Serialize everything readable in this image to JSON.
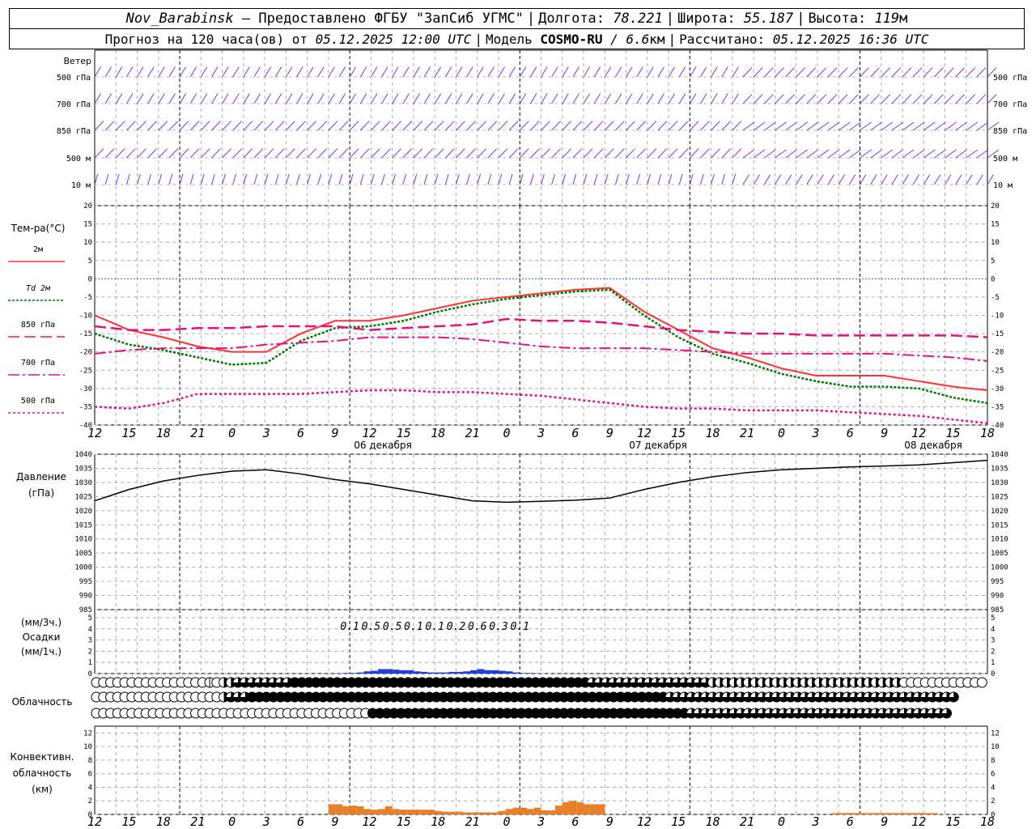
{
  "header": {
    "station": "Nov_Barabinsk",
    "provider": "— Предоставлено ФГБУ \"ЗапСиб УГМС\"",
    "lon_label": "Долгота:",
    "lon": "78.221",
    "lat_label": "Широта:",
    "lat": "55.187",
    "alt_label": "Высота:",
    "alt": "119",
    "alt_unit": "м",
    "fc_label": "Прогноз на 120 часа(ов) от",
    "fc_start": "05.12.2025 12:00 UTC",
    "model_label": "Модель",
    "model": "COSMO-RU",
    "model_res": "/ 6.6",
    "model_res_unit": "км",
    "calc_label": "Рассчитано:",
    "calc_time": "05.12.2025 16:36 UTC",
    "sep": "|"
  },
  "wind_panel": {
    "title": "Ветер",
    "levels": [
      "500 гПа",
      "700 гПа",
      "850 гПа",
      "500 м",
      "10 м"
    ]
  },
  "temp_panel": {
    "title": "Тем-ра(°C)",
    "legend": [
      "2м",
      "Td 2м",
      "850 гПа",
      "700 гПа",
      "500 гПа"
    ]
  },
  "pressure_panel": {
    "title": "Давление",
    "unit": "(гПа)"
  },
  "precip_panel": {
    "unit_top": "(мм/3ч.)",
    "title": "Осадки",
    "unit_bottom": "(мм/1ч.)"
  },
  "cloud_panel": {
    "title": "Облачность"
  },
  "conv_panel": {
    "title": "Конвективн. облачность (км)",
    "line1": "Конвективн.",
    "line2": "облачность",
    "line3": "(км)"
  },
  "colors": {
    "t2m": "#ff3333",
    "td2m": "#007700",
    "t850": "#e8107a",
    "t700": "#e8107a",
    "t500": "#e8107a",
    "pressure": "#000000",
    "precip": "#1f3fd6",
    "conv": "#e8802a",
    "wind": "#8a2be2",
    "zero_line": "#3355ff"
  },
  "chart_data": [
    {
      "type": "line",
      "title": "Тем-ра(°C)",
      "x": [
        "12",
        "15",
        "18",
        "21",
        "0",
        "3",
        "6",
        "9",
        "12",
        "15",
        "18",
        "21",
        "0",
        "3",
        "6",
        "9",
        "12",
        "15",
        "18",
        "21",
        "0",
        "3",
        "6",
        "9",
        "12",
        "15",
        "18"
      ],
      "day_labels": [
        "06 декабря",
        "07 декабря",
        "08 декабря"
      ],
      "ylim": [
        -40,
        20
      ],
      "yticks": [
        20,
        15,
        10,
        5,
        0,
        -5,
        -10,
        -15,
        -20,
        -25,
        -30,
        -35,
        -40
      ],
      "series": [
        {
          "name": "2м",
          "values": [
            -10,
            -14,
            -16,
            -18.5,
            -20,
            -20,
            -15,
            -11.5,
            -11.5,
            -10,
            -8,
            -6,
            -5,
            -4,
            -3,
            -2.5,
            -9,
            -14,
            -19,
            -21.5,
            -24.5,
            -26.5,
            -26.5,
            -26.5,
            -28,
            -29.5,
            -30.5
          ]
        },
        {
          "name": "Td 2м",
          "values": [
            -15,
            -18,
            -19.5,
            -21.5,
            -23.5,
            -23,
            -17,
            -13.5,
            -13,
            -11.5,
            -9,
            -7,
            -5.5,
            -4.5,
            -3.5,
            -3,
            -10,
            -16,
            -20.5,
            -23,
            -26,
            -28,
            -29.5,
            -29.5,
            -30,
            -32.5,
            -34
          ]
        },
        {
          "name": "850 гПа",
          "values": [
            -13,
            -14,
            -14,
            -13.5,
            -13.5,
            -13,
            -13,
            -13,
            -14,
            -13.5,
            -13,
            -12.5,
            -11,
            -11.5,
            -11.5,
            -12,
            -13,
            -14,
            -14.5,
            -15,
            -15,
            -15.5,
            -15.5,
            -15.5,
            -15.5,
            -15.5,
            -16
          ]
        },
        {
          "name": "700 гПа",
          "values": [
            -20.5,
            -19.5,
            -19,
            -19,
            -19,
            -18,
            -17.5,
            -17,
            -16,
            -16,
            -16,
            -16.5,
            -17.5,
            -18.5,
            -19,
            -19,
            -19,
            -19.5,
            -20,
            -20.5,
            -20.5,
            -20.5,
            -20.5,
            -20.5,
            -21,
            -21.5,
            -22.5
          ]
        },
        {
          "name": "500 гПа",
          "values": [
            -35,
            -35.5,
            -34,
            -31.5,
            -31.5,
            -31.5,
            -31.5,
            -31,
            -30.5,
            -30.5,
            -31,
            -31,
            -31.5,
            -32,
            -33,
            -34,
            -35,
            -35.5,
            -35.5,
            -36,
            -36,
            -36,
            -36.5,
            -37,
            -37.5,
            -38.5,
            -39.5
          ]
        }
      ]
    },
    {
      "type": "line",
      "title": "Давление",
      "ylabel": "(гПа)",
      "x": [
        "12",
        "15",
        "18",
        "21",
        "0",
        "3",
        "6",
        "9",
        "12",
        "15",
        "18",
        "21",
        "0",
        "3",
        "6",
        "9",
        "12",
        "15",
        "18",
        "21",
        "0",
        "3",
        "6",
        "9",
        "12",
        "15",
        "18"
      ],
      "ylim": [
        985,
        1040
      ],
      "yticks": [
        1040,
        1035,
        1030,
        1025,
        1020,
        1015,
        1010,
        1005,
        1000,
        995,
        990,
        985
      ],
      "series": [
        {
          "name": "Давление",
          "values": [
            1023.5,
            1027.5,
            1030.5,
            1032.5,
            1034,
            1034.5,
            1033,
            1031,
            1029.5,
            1027.5,
            1025.5,
            1023.5,
            1023,
            1023.3,
            1023.7,
            1024.5,
            1027.5,
            1030,
            1032,
            1033.5,
            1034.5,
            1035,
            1035.5,
            1035.8,
            1036.2,
            1037,
            1037.8
          ]
        }
      ]
    },
    {
      "type": "bar",
      "title": "Осадки",
      "ylim": [
        0,
        5
      ],
      "yticks": [
        5,
        4,
        3,
        2,
        1,
        0
      ],
      "labels_3h_hours": [
        36,
        39,
        42,
        45,
        48,
        51,
        54,
        57,
        60
      ],
      "labels_3h": [
        "0.1",
        "0.5",
        "0.5",
        "0.1",
        "0.1",
        "0.2",
        "0.6",
        "0.3",
        "0.1"
      ],
      "hourly_hours": [
        34,
        35,
        36,
        37,
        38,
        39,
        40,
        41,
        42,
        43,
        44,
        45,
        46,
        47,
        48,
        49,
        50,
        51,
        52,
        53,
        54,
        55,
        56,
        57,
        58,
        59,
        60,
        61,
        62
      ],
      "hourly_values": [
        0.02,
        0.05,
        0.05,
        0.1,
        0.2,
        0.25,
        0.4,
        0.4,
        0.35,
        0.3,
        0.3,
        0.2,
        0.15,
        0.1,
        0.1,
        0.1,
        0.15,
        0.15,
        0.2,
        0.3,
        0.4,
        0.3,
        0.3,
        0.25,
        0.2,
        0.1,
        0.05,
        0.05,
        0.02
      ]
    },
    {
      "type": "bar",
      "title": "Конвективн. облачность (км)",
      "ylim": [
        0,
        13
      ],
      "yticks": [
        12,
        10,
        8,
        6,
        4,
        2,
        0
      ],
      "hours": [
        33,
        34,
        35,
        36,
        37,
        38,
        39,
        40,
        41,
        42,
        43,
        44,
        45,
        46,
        47,
        48,
        49,
        50,
        51,
        52,
        53,
        54,
        55,
        56,
        57,
        58,
        59,
        60,
        61,
        62,
        63,
        64,
        65,
        66,
        67,
        68,
        69,
        70,
        71
      ],
      "values": [
        1.5,
        1.5,
        1.2,
        1.3,
        1.2,
        0.8,
        0.7,
        0.8,
        1.2,
        0.8,
        0.7,
        0.7,
        0.7,
        0.7,
        0.7,
        0.5,
        0.4,
        0.4,
        0.4,
        0.3,
        0.3,
        0.3,
        0.3,
        0.3,
        0.5,
        0.8,
        1.0,
        1.0,
        0.8,
        1.0,
        0.6,
        0.6,
        1.3,
        1.8,
        2.0,
        1.8,
        1.5,
        1.5,
        1.5
      ],
      "small_hours": [
        104,
        105,
        106,
        107,
        108,
        109,
        110,
        111,
        112,
        113,
        114,
        115,
        116,
        117,
        118
      ],
      "small_values": [
        0.2,
        0.2,
        0.2,
        0.2,
        0.2,
        0.2,
        0.2,
        0.2,
        0.2,
        0.2,
        0.2,
        0.2,
        0.2,
        0.2,
        0.2
      ]
    }
  ],
  "clouds": {
    "low": [
      0,
      0,
      0,
      0,
      0,
      0,
      0,
      0,
      0,
      0,
      0,
      0,
      0,
      0,
      0,
      0,
      0,
      0,
      0,
      0,
      0,
      0,
      0,
      0,
      0,
      0,
      0,
      0,
      0,
      0,
      0,
      0,
      0,
      0,
      0,
      0,
      0,
      0,
      0,
      0,
      0,
      0,
      0,
      0,
      0,
      0,
      0,
      0,
      0,
      0,
      0,
      0,
      0,
      0,
      0,
      0,
      0,
      0,
      0,
      0,
      0,
      0,
      0,
      0,
      0,
      0,
      0,
      0,
      0,
      0,
      0,
      0,
      0,
      0,
      0,
      0,
      0,
      0,
      0,
      0,
      0,
      0,
      0,
      0,
      0,
      0,
      0,
      0,
      0,
      0,
      0,
      0,
      0,
      0,
      0,
      0,
      0,
      0,
      0,
      0,
      0,
      0,
      0,
      0,
      0,
      0,
      0,
      0,
      0,
      0,
      0,
      0,
      0,
      0,
      0,
      0,
      0,
      0,
      0,
      0,
      0,
      0,
      0,
      0,
      0,
      0
    ],
    "rows": [
      [
        0,
        0,
        0,
        0,
        0,
        0,
        0,
        0,
        0,
        0,
        0,
        0,
        0,
        0,
        0,
        0,
        1,
        0,
        2,
        2,
        3,
        3,
        3,
        3,
        3,
        3,
        3,
        3,
        4,
        4,
        4,
        4,
        4,
        4,
        4,
        4,
        4,
        4,
        4,
        4,
        4,
        4,
        4,
        4,
        4,
        4,
        4,
        4,
        4,
        4,
        4,
        4,
        4,
        4,
        4,
        4,
        4,
        4,
        4,
        4,
        4,
        4,
        4,
        4,
        4,
        4,
        4,
        4,
        4,
        4,
        3,
        3,
        3,
        3,
        3,
        3,
        3,
        3,
        3,
        3,
        3,
        3,
        3,
        3,
        3,
        3,
        3,
        2,
        2,
        2,
        2,
        2,
        2,
        2,
        2,
        2,
        2,
        2,
        2,
        2,
        2,
        2,
        2,
        2,
        2,
        2,
        2,
        2,
        2,
        2,
        2,
        2,
        2,
        2,
        0,
        0,
        0,
        0,
        0,
        0,
        0,
        0,
        0,
        0,
        0,
        0
      ],
      [
        0,
        0,
        0,
        0,
        0,
        0,
        0,
        0,
        0,
        0,
        0,
        0,
        0,
        0,
        0,
        0,
        0,
        0,
        2,
        3,
        3,
        3,
        4,
        4,
        4,
        4,
        4,
        4,
        4,
        4,
        4,
        4,
        4,
        4,
        4,
        4,
        4,
        4,
        4,
        4,
        4,
        4,
        4,
        4,
        4,
        4,
        4,
        4,
        4,
        4,
        4,
        4,
        4,
        4,
        4,
        4,
        4,
        4,
        4,
        4,
        4,
        4,
        4,
        4,
        4,
        4,
        4,
        4,
        4,
        4,
        4,
        4,
        4,
        4,
        4,
        4,
        4,
        4,
        4,
        4,
        4,
        3,
        3,
        3,
        3,
        3,
        3,
        3,
        3,
        3,
        3,
        3,
        3,
        3,
        3,
        3,
        3,
        3,
        3,
        3,
        3,
        3,
        3,
        3,
        3,
        3,
        3,
        3,
        3,
        3,
        3,
        3,
        3,
        3,
        3,
        3,
        3,
        3,
        3,
        3,
        3,
        3
      ],
      [
        0,
        0,
        0,
        0,
        0,
        0,
        0,
        0,
        0,
        0,
        0,
        0,
        0,
        0,
        0,
        0,
        0,
        0,
        0,
        0,
        0,
        0,
        0,
        0,
        0,
        0,
        0,
        0,
        0,
        0,
        0,
        0,
        0,
        0,
        0,
        0,
        0,
        0,
        0,
        4,
        4,
        4,
        4,
        4,
        4,
        4,
        4,
        4,
        4,
        4,
        4,
        4,
        4,
        4,
        4,
        4,
        4,
        4,
        4,
        4,
        4,
        4,
        4,
        4,
        4,
        4,
        4,
        4,
        4,
        4,
        4,
        4,
        4,
        4,
        4,
        4,
        4,
        4,
        4,
        4,
        4,
        4,
        4,
        4,
        3,
        3,
        3,
        3,
        3,
        3,
        3,
        3,
        3,
        3,
        3,
        3,
        3,
        3,
        3,
        3,
        3,
        3,
        3,
        3,
        3,
        3,
        3,
        3,
        3,
        3,
        3,
        3,
        3,
        3,
        3,
        3,
        3,
        3,
        3,
        3,
        3
      ]
    ]
  }
}
